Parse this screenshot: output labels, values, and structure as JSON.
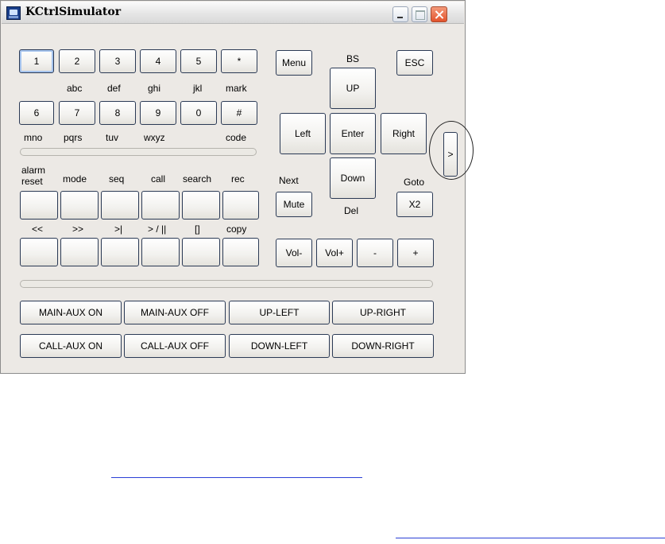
{
  "window": {
    "title": "KCtrlSimulator"
  },
  "keypad": {
    "row1": [
      "1",
      "2",
      "3",
      "4",
      "5",
      "*"
    ],
    "row1_sub": [
      "abc",
      "def",
      "ghi",
      "jkl",
      "mark"
    ],
    "row2": [
      "6",
      "7",
      "8",
      "9",
      "0",
      "#"
    ],
    "row2_sub": [
      "mno",
      "pqrs",
      "tuv",
      "wxyz",
      "code"
    ]
  },
  "func": {
    "labels1": [
      "alarm",
      "reset",
      "mode",
      "seq",
      "call",
      "search",
      "rec"
    ],
    "labels2": [
      "<<",
      ">>",
      ">|",
      "> / ||",
      "[]",
      "copy"
    ]
  },
  "nav": {
    "menu": "Menu",
    "bs": "BS",
    "esc": "ESC",
    "up": "UP",
    "left": "Left",
    "enter": "Enter",
    "right": "Right",
    "expand": ">",
    "next": "Next",
    "down": "Down",
    "goto": "Goto",
    "mute": "Mute",
    "del": "Del",
    "x2": "X2",
    "vol_minus": "Vol-",
    "vol_plus": "Vol+",
    "minus": "-",
    "plus": "+"
  },
  "aux": {
    "main_on": "MAIN-AUX ON",
    "main_off": "MAIN-AUX OFF",
    "up_left": "UP-LEFT",
    "up_right": "UP-RIGHT",
    "call_on": "CALL-AUX ON",
    "call_off": "CALL-AUX OFF",
    "down_left": "DOWN-LEFT",
    "down_right": "DOWN-RIGHT"
  },
  "colors": {
    "window_bg": "#ece9e5",
    "button_border": "#2b3a55",
    "link": "#2a3fd6"
  }
}
